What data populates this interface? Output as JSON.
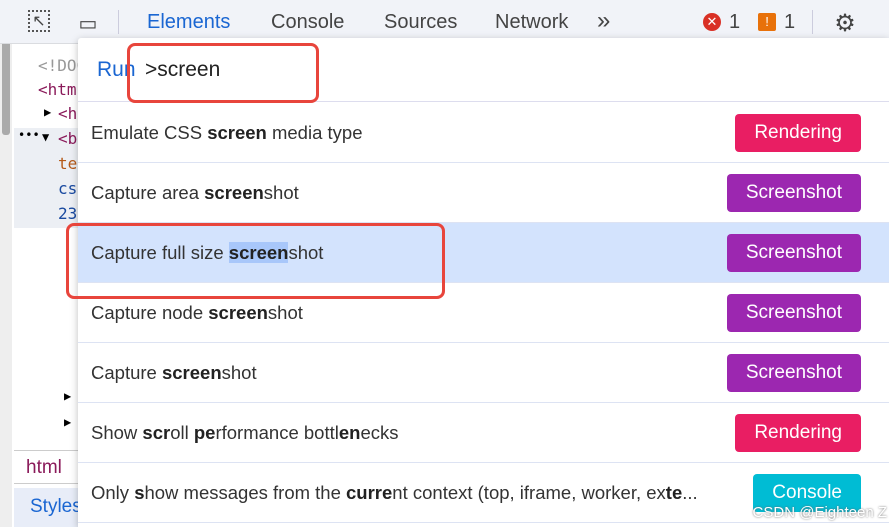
{
  "toolbar": {
    "tabs": [
      "Elements",
      "Console",
      "Sources",
      "Network"
    ],
    "more": "»",
    "error_count": "1",
    "warning_count": "1"
  },
  "elements_tree": [
    "<!DOC",
    "<htm",
    "<h",
    "<b",
    "te",
    "cs",
    "23"
  ],
  "breadcrumb": "html",
  "styles_tab": "Styles",
  "palette": {
    "prefix": "Run",
    "query": ">screen",
    "items": [
      {
        "segments": [
          {
            "t": "Emulate CSS "
          },
          {
            "t": "screen",
            "b": true
          },
          {
            "t": " media type"
          }
        ],
        "badge": "Rendering",
        "color": "#e91e63"
      },
      {
        "segments": [
          {
            "t": "Capture area "
          },
          {
            "t": "screen",
            "b": true
          },
          {
            "t": "shot"
          }
        ],
        "badge": "Screenshot",
        "color": "#9c27b0"
      },
      {
        "segments": [
          {
            "t": "Capture full size "
          },
          {
            "t": "screen",
            "b": true,
            "hl": true
          },
          {
            "t": "shot"
          }
        ],
        "badge": "Screenshot",
        "color": "#9c27b0",
        "selected": true
      },
      {
        "segments": [
          {
            "t": "Capture node "
          },
          {
            "t": "screen",
            "b": true
          },
          {
            "t": "shot"
          }
        ],
        "badge": "Screenshot",
        "color": "#9c27b0"
      },
      {
        "segments": [
          {
            "t": "Capture "
          },
          {
            "t": "screen",
            "b": true
          },
          {
            "t": "shot"
          }
        ],
        "badge": "Screenshot",
        "color": "#9c27b0"
      },
      {
        "segments": [
          {
            "t": "Show "
          },
          {
            "t": "scr",
            "b": true
          },
          {
            "t": "oll "
          },
          {
            "t": "pe",
            "b": true
          },
          {
            "t": "rformance bottl"
          },
          {
            "t": "en",
            "b": true
          },
          {
            "t": "ecks"
          }
        ],
        "badge": "Rendering",
        "color": "#e91e63"
      },
      {
        "segments": [
          {
            "t": "Only "
          },
          {
            "t": "s",
            "b": true
          },
          {
            "t": "how messages from the "
          },
          {
            "t": "curre",
            "b": true
          },
          {
            "t": "nt context (top, iframe, worker, ex"
          },
          {
            "t": "te",
            "b": true
          },
          {
            "t": "..."
          }
        ],
        "badge": "Console",
        "color": "#00bcd4"
      }
    ]
  },
  "watermark": "CSDN @Eighteen Z"
}
